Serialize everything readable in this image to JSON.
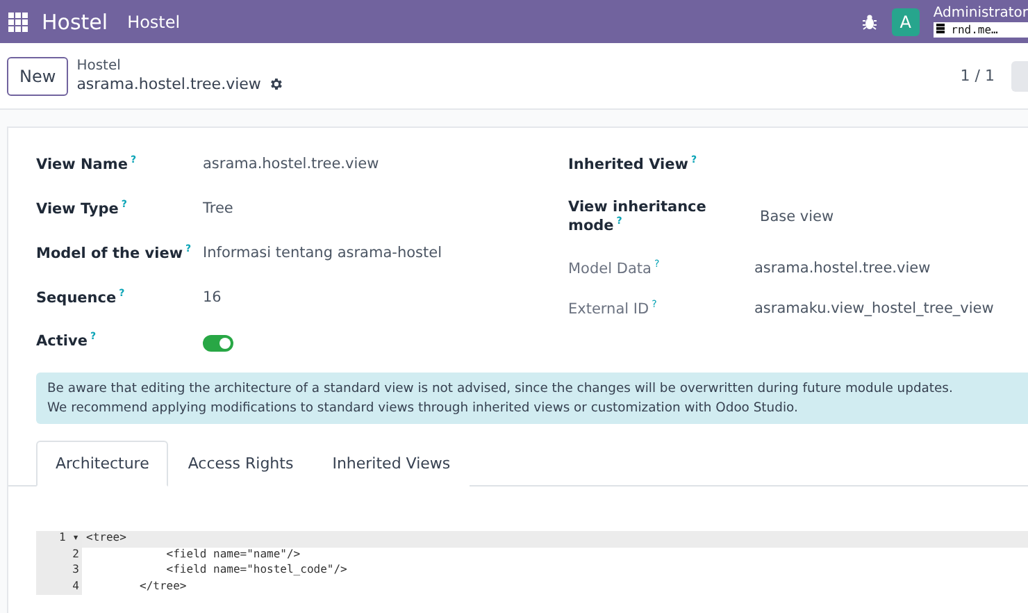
{
  "navbar": {
    "app_name": "Hostel",
    "menu": "Hostel",
    "user_initial": "A",
    "user_name": "Administrator",
    "database": "rnd.me…"
  },
  "control_panel": {
    "new_button": "New",
    "breadcrumb": "Hostel",
    "record_title": "asrama.hostel.tree.view",
    "pager": "1 / 1"
  },
  "left_fields": [
    {
      "kind": "text",
      "label": "View Name",
      "help": "?",
      "value": "asrama.hostel.tree.view"
    },
    {
      "kind": "text",
      "label": "View Type",
      "help": "?",
      "value": "Tree"
    },
    {
      "kind": "text",
      "label": "Model of the view",
      "help": "?",
      "value": "Informasi tentang asrama-hostel"
    },
    {
      "kind": "text",
      "label": "Sequence",
      "help": "?",
      "value": "16"
    },
    {
      "kind": "toggle",
      "label": "Active",
      "help": "?",
      "on": true
    }
  ],
  "right_fields": [
    {
      "label": "Inherited View",
      "help": "?",
      "readonly": false
    },
    {
      "label": "View inheritance mode",
      "help": "?",
      "value": "Base view",
      "readonly": false
    },
    {
      "label": "Model Data",
      "help": "?",
      "value": "asrama.hostel.tree.view",
      "readonly": true
    },
    {
      "label": "External ID",
      "help": "?",
      "value": "asramaku.view_hostel_tree_view",
      "readonly": true
    }
  ],
  "alert": [
    "Be aware that editing the architecture of a standard view is not advised, since the changes will be overwritten during future module updates.",
    "We recommend applying modifications to standard views through inherited views or customization with Odoo Studio."
  ],
  "tabs": [
    {
      "label": "Architecture",
      "selected": true
    },
    {
      "label": "Access Rights",
      "selected": false
    },
    {
      "label": "Inherited Views",
      "selected": false
    }
  ],
  "code": [
    {
      "number": "1",
      "fold": "▾",
      "text": "<tree>",
      "active": true
    },
    {
      "number": "2",
      "text": "            <field name=\"name\"/>",
      "active": false
    },
    {
      "number": "3",
      "text": "            <field name=\"hostel_code\"/>",
      "active": false
    },
    {
      "number": "4",
      "text": "        </tree>",
      "active": false
    }
  ]
}
